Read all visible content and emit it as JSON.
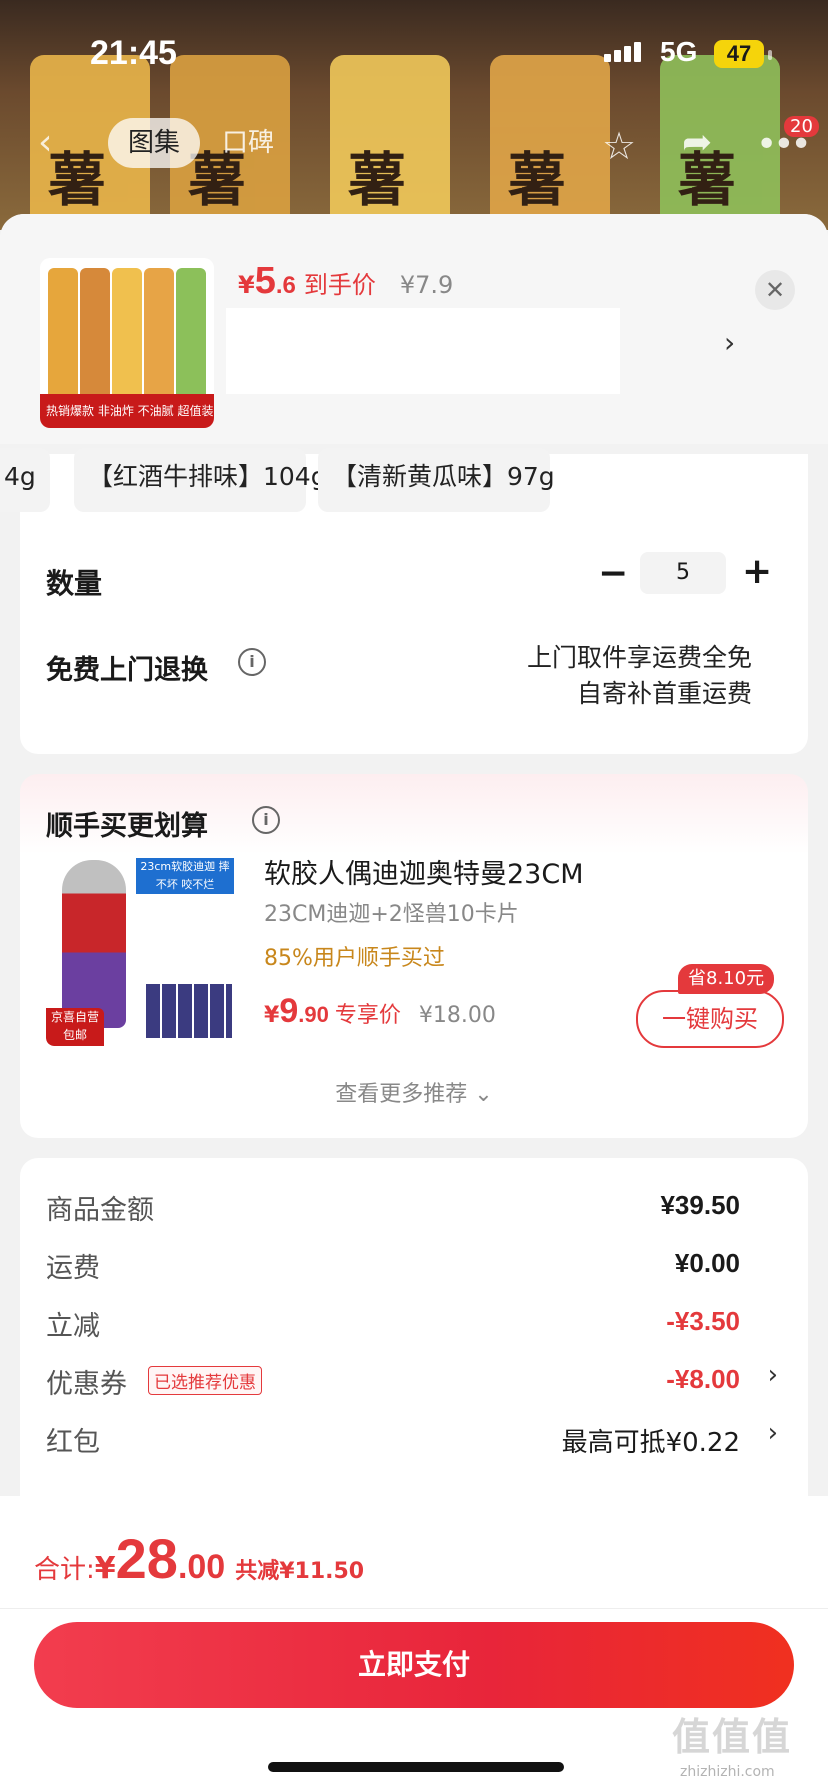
{
  "status_bar": {
    "time": "21:45",
    "network": "5G",
    "battery": "47"
  },
  "top_nav": {
    "tab_gallery": "图集",
    "tab_reviews": "口碑",
    "cart_count": "20"
  },
  "product_header": {
    "price_int": "5",
    "price_dec": ".6",
    "price_label": "到手价",
    "original_price": "¥7.9",
    "thumb_badge": "热销爆款  非油炸 不油腻 超值装",
    "bg_word": "薯愿"
  },
  "variants": [
    "4g",
    "【红酒牛排味】104g",
    "【清新黄瓜味】97g"
  ],
  "quantity": {
    "label": "数量",
    "value": "5"
  },
  "returns": {
    "label": "免费上门退换",
    "line1": "上门取件享运费全免",
    "line2": "自寄补首重运费"
  },
  "recommend": {
    "title": "顺手买更划算",
    "name": "软胶人偶迪迦奥特曼23CM",
    "spec": "23CM迪迦+2怪兽10卡片",
    "bought": "85%用户顺手买过",
    "price_int": "9",
    "price_dec": ".90",
    "price_label": "专享价",
    "original_price": "¥18.00",
    "save_badge": "省8.10元",
    "buy_label": "一键购买",
    "more_label": "查看更多推荐 ⌄",
    "img_banner": "23cm软胶迪迦 摔不坏 咬不烂",
    "img_tag": "京喜自营 包邮"
  },
  "summary": {
    "rows": [
      {
        "label": "商品金额",
        "value": "¥39.50"
      },
      {
        "label": "运费",
        "value": "¥0.00"
      },
      {
        "label": "立减",
        "value": "-¥3.50"
      },
      {
        "label": "优惠券",
        "value": "-¥8.00",
        "tag": "已选推荐优惠"
      },
      {
        "label": "红包",
        "value": "最高可抵¥0.22"
      }
    ]
  },
  "footer": {
    "total_label": "合计:",
    "total_int": "28",
    "total_dec": ".00",
    "total_saved": "共减¥11.50",
    "pay_label": "立即支付"
  },
  "watermark": {
    "text": "值值值",
    "site": "zhizhizhi.com"
  },
  "colors": {
    "accent": "#e4393c",
    "bought": "#c8871c"
  }
}
